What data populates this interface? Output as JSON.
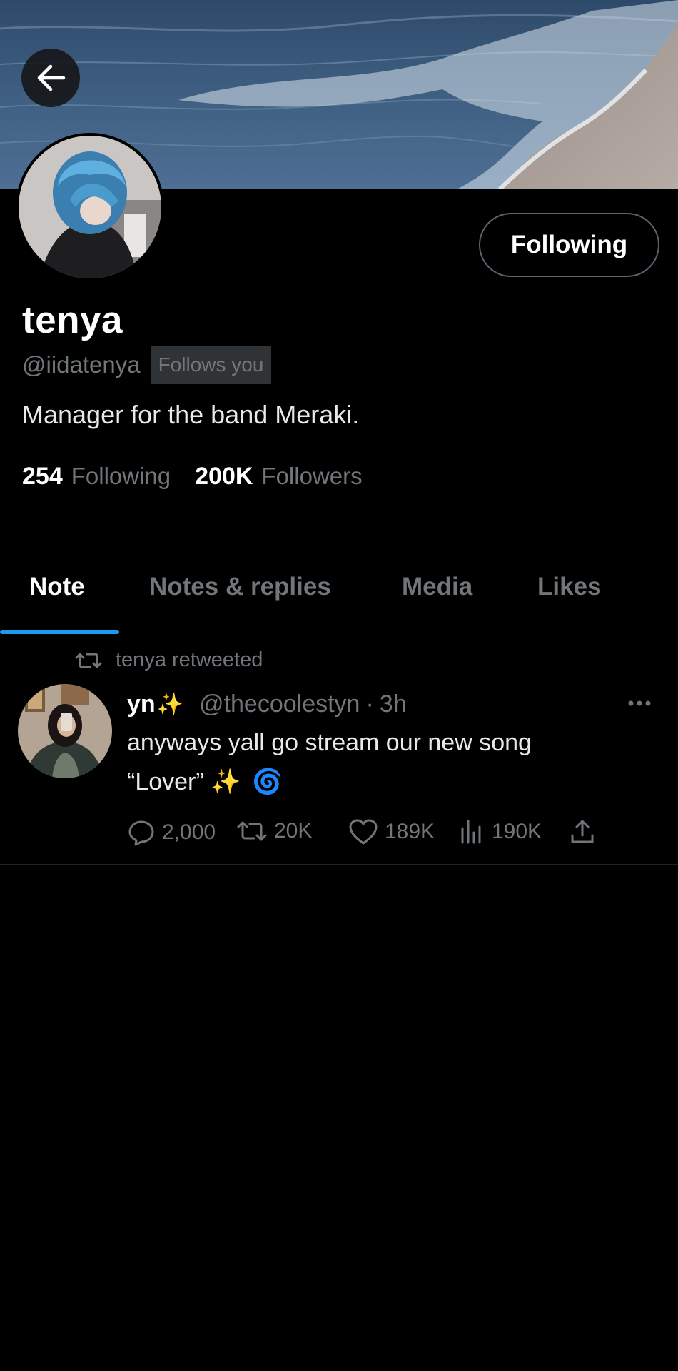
{
  "profile": {
    "display_name": "tenya",
    "handle": "@iidatenya",
    "follows_you_badge": "Follows you",
    "bio": "Manager for the band Meraki.",
    "following_button_label": "Following",
    "stats": {
      "following_count": "254",
      "following_label": "Following",
      "followers_count": "200K",
      "followers_label": "Followers"
    }
  },
  "tabs": [
    {
      "label": "Note",
      "active": true
    },
    {
      "label": "Notes & replies",
      "active": false
    },
    {
      "label": "Media",
      "active": false
    },
    {
      "label": "Likes",
      "active": false
    }
  ],
  "tweet": {
    "retweet_label": "tenya retweeted",
    "author_name": "yn",
    "author_emoji": "✨",
    "author_handle": "@thecoolestyn",
    "separator": "·",
    "time": "3h",
    "text_line1": "anyways yall go stream our new song",
    "text_line2": "“Lover” ✨",
    "text_emoji": "🌀",
    "actions": {
      "replies": "2,000",
      "retweets": "20K",
      "likes": "189K",
      "views": "190K"
    }
  },
  "icons": {
    "back": "arrow-left-icon",
    "retweet": "retweet-icon",
    "reply": "reply-icon",
    "like": "heart-icon",
    "views": "bar-chart-icon",
    "share": "share-icon",
    "more": "more-dots-icon"
  },
  "colors": {
    "background": "#000000",
    "accent": "#1d9bf0",
    "muted": "#71767b",
    "text": "#e7e9ea",
    "badge_bg": "#2f3336"
  }
}
